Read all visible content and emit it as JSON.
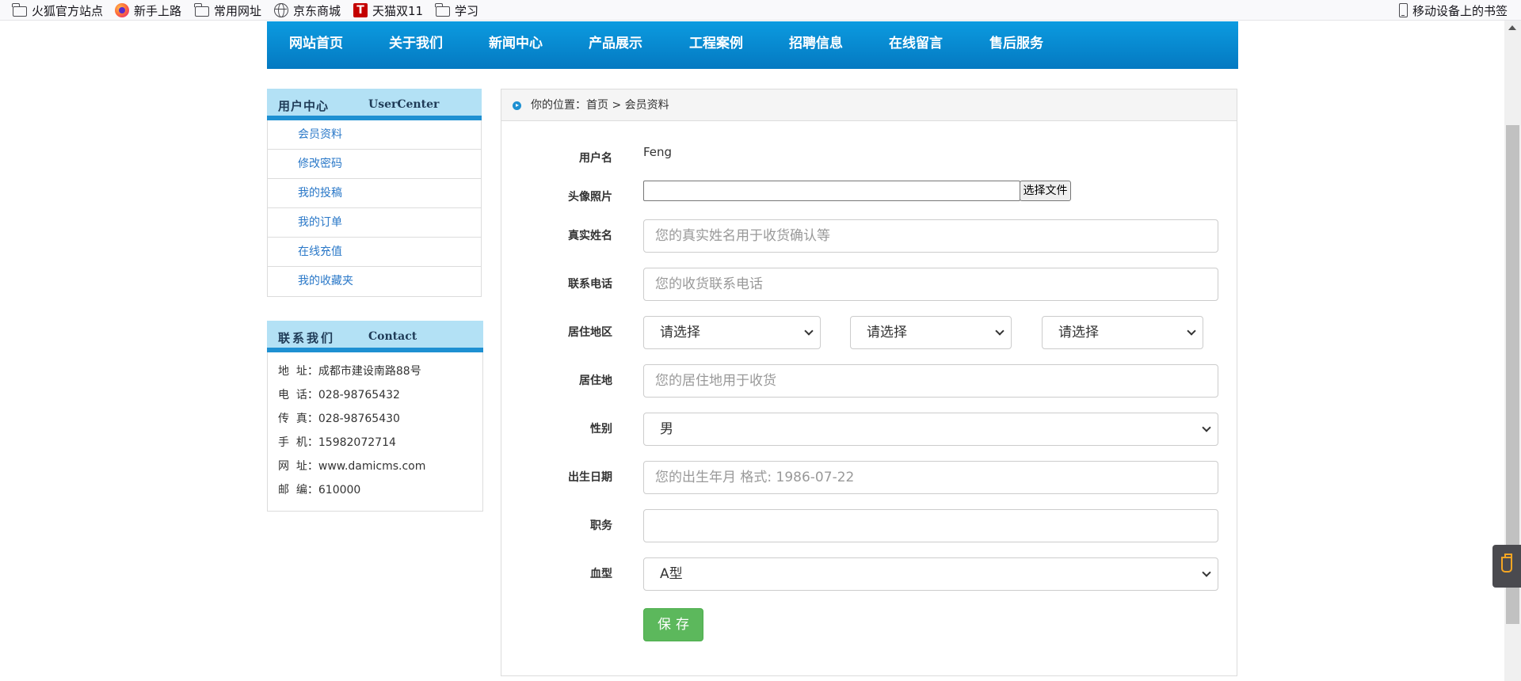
{
  "bookmarks": {
    "items": [
      {
        "label": "火狐官方站点",
        "icon": "folder-icon"
      },
      {
        "label": "新手上路",
        "icon": "firefox-icon"
      },
      {
        "label": "常用网址",
        "icon": "folder-icon"
      },
      {
        "label": "京东商城",
        "icon": "globe-icon"
      },
      {
        "label": "天猫双11",
        "icon": "tmall-icon",
        "icon_text": "T"
      },
      {
        "label": "学习",
        "icon": "folder-icon"
      }
    ],
    "mobile": {
      "label": "移动设备上的书签",
      "icon": "mobile-icon"
    }
  },
  "nav": {
    "items": [
      "网站首页",
      "关于我们",
      "新闻中心",
      "产品展示",
      "工程案例",
      "招聘信息",
      "在线留言",
      "售后服务"
    ],
    "color": "#0a8fd6"
  },
  "user_center": {
    "title_zh": "用户中心",
    "title_en": "UserCenter",
    "items": [
      "会员资料",
      "修改密码",
      "我的投稿",
      "我的订单",
      "在线充值",
      "我的收藏夹"
    ]
  },
  "contact": {
    "title_zh": "联系我们",
    "title_en": "Contact",
    "lines": [
      "地  址：成都市建设南路88号",
      "电  话：028-98765432",
      "传  真：028-98765430",
      "手  机：15982072714",
      "网  址：www.damicms.com",
      "邮  编：610000"
    ]
  },
  "breadcrumb": {
    "prefix": "你的位置：",
    "home": "首页",
    "separator": " > ",
    "current": "会员资料"
  },
  "form": {
    "username": {
      "label": "用户名",
      "value": "Feng"
    },
    "avatar": {
      "label": "头像照片",
      "button": "选择文件"
    },
    "realname": {
      "label": "真实姓名",
      "placeholder": "您的真实姓名用于收货确认等"
    },
    "phone": {
      "label": "联系电话",
      "placeholder": "您的收货联系电话"
    },
    "region": {
      "label": "居住地区",
      "selects": [
        "请选择",
        "请选择",
        "请选择"
      ]
    },
    "address": {
      "label": "居住地",
      "placeholder": "您的居住地用于收货"
    },
    "gender": {
      "label": "性别",
      "value": "男"
    },
    "birthday": {
      "label": "出生日期",
      "placeholder": "您的出生年月 格式: 1986-07-22"
    },
    "job": {
      "label": "职务",
      "value": ""
    },
    "blood": {
      "label": "血型",
      "value": "A型"
    },
    "save": "保存"
  }
}
